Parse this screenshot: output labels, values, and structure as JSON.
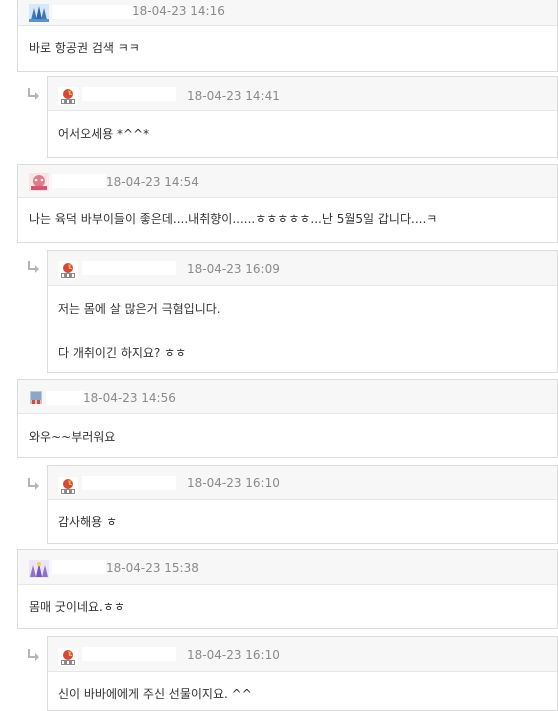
{
  "comments": [
    {
      "type": "top",
      "timestamp": "18-04-23 14:16",
      "lines": [
        "바로 항공권 검색 ㅋㅋ"
      ]
    },
    {
      "type": "reply",
      "timestamp": "18-04-23 14:41",
      "lines": [
        "어서오세용 *^^*"
      ]
    },
    {
      "type": "top",
      "timestamp": "18-04-23 14:54",
      "lines": [
        "나는 육덕 바부이들이 좋은데....내취향이......ㅎㅎㅎㅎㅎ...난 5월5일 갑니다....ㅋ"
      ]
    },
    {
      "type": "reply",
      "timestamp": "18-04-23 16:09",
      "lines": [
        "저는 몸에 살 많은거 극혐입니다.",
        "다 개취이긴 하지요? ㅎㅎ"
      ]
    },
    {
      "type": "top",
      "timestamp": "18-04-23 14:56",
      "lines": [
        "와우~~부러워요"
      ]
    },
    {
      "type": "reply",
      "timestamp": "18-04-23 16:10",
      "lines": [
        "감사해용 ㅎ"
      ]
    },
    {
      "type": "top",
      "timestamp": "18-04-23 15:38",
      "lines": [
        "몸매 굿이네요.ㅎㅎ"
      ]
    },
    {
      "type": "reply",
      "timestamp": "18-04-23 16:10",
      "lines": [
        "신이 바바에에게 주신 선물이지요. ^^"
      ]
    }
  ],
  "icons": {
    "reply_arrow": "reply-arrow-icon",
    "avatar": "avatar-icon"
  },
  "colors": {
    "header_bg": "#f7f7f7",
    "border": "#dcdcdc",
    "timestamp": "#8a8a8a",
    "text": "#333333",
    "reply_arrow": "#b5b5b5"
  }
}
